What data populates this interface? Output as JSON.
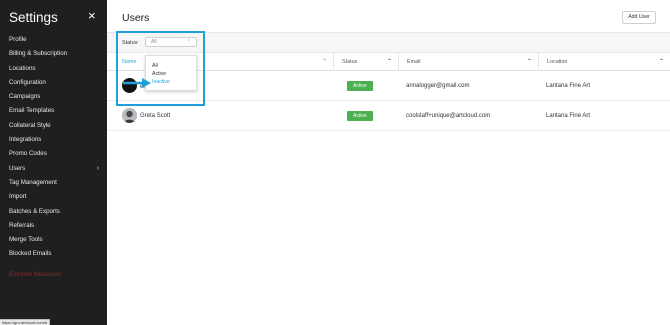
{
  "sidebar": {
    "title": "Settings",
    "close_icon": "×",
    "items": [
      {
        "label": "Profile"
      },
      {
        "label": "Billing & Subscription"
      },
      {
        "label": "Locations"
      },
      {
        "label": "Configuration"
      },
      {
        "label": "Campaigns"
      },
      {
        "label": "Email Templates"
      },
      {
        "label": "Collateral Style"
      },
      {
        "label": "Integrations"
      },
      {
        "label": "Promo Codes"
      },
      {
        "label": "Users",
        "chevron": "›"
      },
      {
        "label": "Tag Management"
      },
      {
        "label": "Import"
      },
      {
        "label": "Batches & Exports"
      },
      {
        "label": "Referrals"
      },
      {
        "label": "Merge Tools"
      },
      {
        "label": "Blocked Emails"
      }
    ],
    "danger_item": "Extreme Measures",
    "danger_color": "#8b2a2a",
    "status_url": "https://gro.artcloud.com/#"
  },
  "main": {
    "title": "Users",
    "add_user_label": "Add User",
    "filter": {
      "label": "Status:",
      "selected": "All",
      "options": [
        "All",
        "Active",
        "Inactive"
      ],
      "highlighted_option": "Inactive"
    },
    "table": {
      "columns": [
        "Name",
        "Status",
        "Email",
        "Location"
      ],
      "rows": [
        {
          "name": "",
          "name_visible_fragment": "el",
          "status": "Active",
          "email": "annalogger@gmail.com",
          "location": "Lantana Fine Art"
        },
        {
          "name": "Greta Scott",
          "status": "Active",
          "email": "coolstaff+unique@artcloud.com",
          "location": "Lantana Fine Art"
        }
      ]
    }
  },
  "colors": {
    "sidebar_bg": "#1f1f1f",
    "accent": "#2aa6d9",
    "active_badge": "#4caf50",
    "highlight_box": "#1fa0d8"
  },
  "icons": {
    "close": "close-icon",
    "chevron": "chevron-right-icon",
    "sort": "sort-up-icon",
    "select": "chevron-up-icon"
  }
}
